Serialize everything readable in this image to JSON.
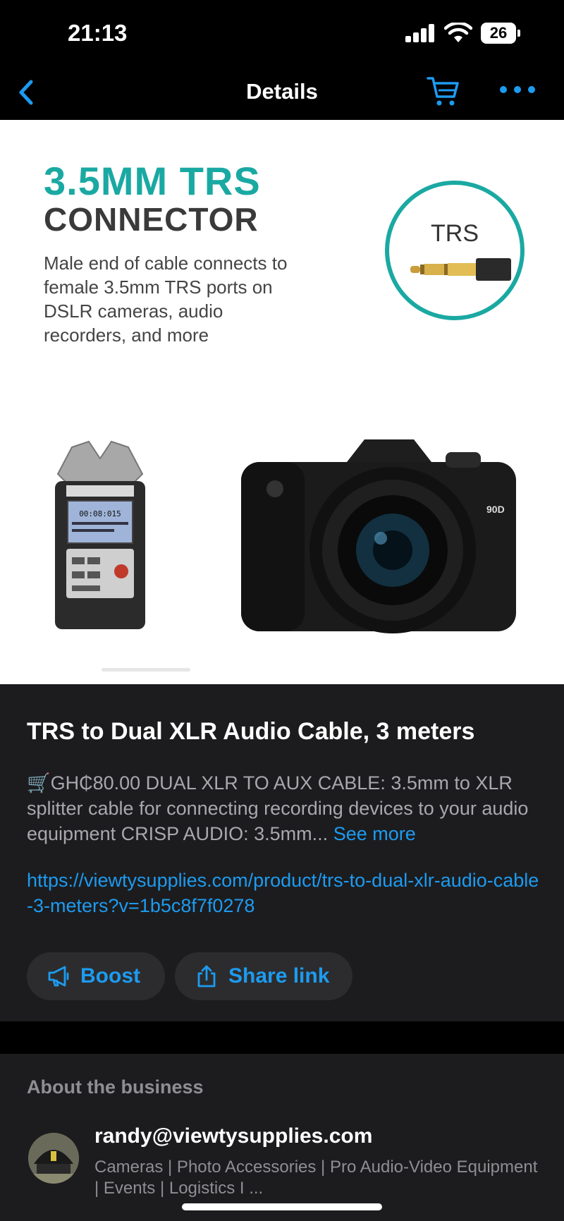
{
  "status_bar": {
    "time": "21:13",
    "battery": "26"
  },
  "nav": {
    "title": "Details",
    "back_icon": "chevron-left-icon",
    "cart_icon": "cart-icon",
    "more_icon": "more-horizontal-icon",
    "accent_color": "#1d9bf0"
  },
  "product_image": {
    "headline_line1": "3.5MM TRS",
    "headline_line2": "CONNECTOR",
    "description": "Male end of cable connects to female 3.5mm TRS ports on DSLR cameras, audio recorders, and more",
    "connector_label": "TRS",
    "camera_model_badge": "90D",
    "recorder_display": "00:08:015",
    "accent_color": "#1aa9a2"
  },
  "product": {
    "title": "TRS to Dual XLR Audio Cable, 3 meters",
    "description": "🛒GH₵80.00 DUAL XLR TO AUX CABLE: 3.5mm to XLR splitter cable for connecting recording devices to your audio equipment CRISP AUDIO: 3.5mm...",
    "see_more": "See more",
    "link": "https://viewtysupplies.com/product/trs-to-dual-xlr-audio-cable-3-meters?v=1b5c8f7f0278"
  },
  "actions": {
    "boost_label": "Boost",
    "boost_icon": "megaphone-icon",
    "share_label": "Share link",
    "share_icon": "share-icon"
  },
  "about": {
    "heading": "About the business",
    "business_name": "randy@viewtysupplies.com",
    "business_description": "Cameras | Photo Accessories | Pro Audio-Video Equipment | Events | Logistics I ..."
  }
}
